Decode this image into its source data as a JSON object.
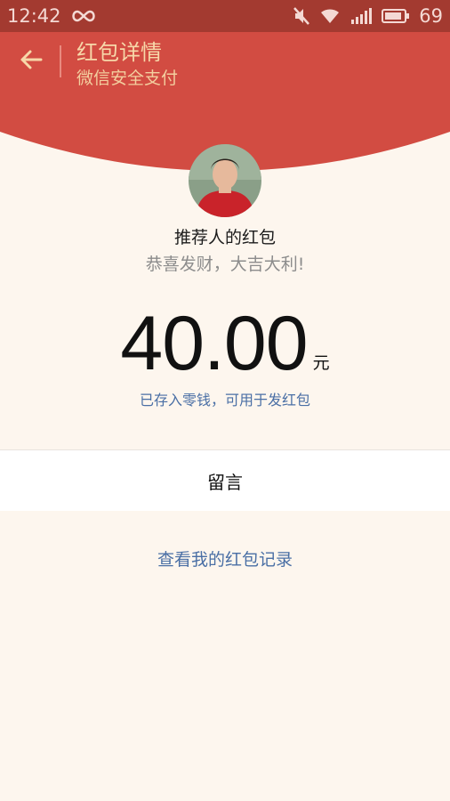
{
  "status_bar": {
    "time": "12:42",
    "battery": "69"
  },
  "header": {
    "title": "红包详情",
    "subtitle": "微信安全支付"
  },
  "packet": {
    "sender": "推荐人的红包",
    "wish": "恭喜发财，大吉大利!",
    "amount": "40.00",
    "unit": "元",
    "stored_note": "已存入零钱，可用于发红包"
  },
  "message": {
    "label": "留言"
  },
  "footer": {
    "record_link": "查看我的红包记录"
  },
  "colors": {
    "header_red": "#d24c42",
    "status_red": "#a33a30",
    "link_blue": "#4a6fa5",
    "title_gold": "#f7d8a9"
  }
}
